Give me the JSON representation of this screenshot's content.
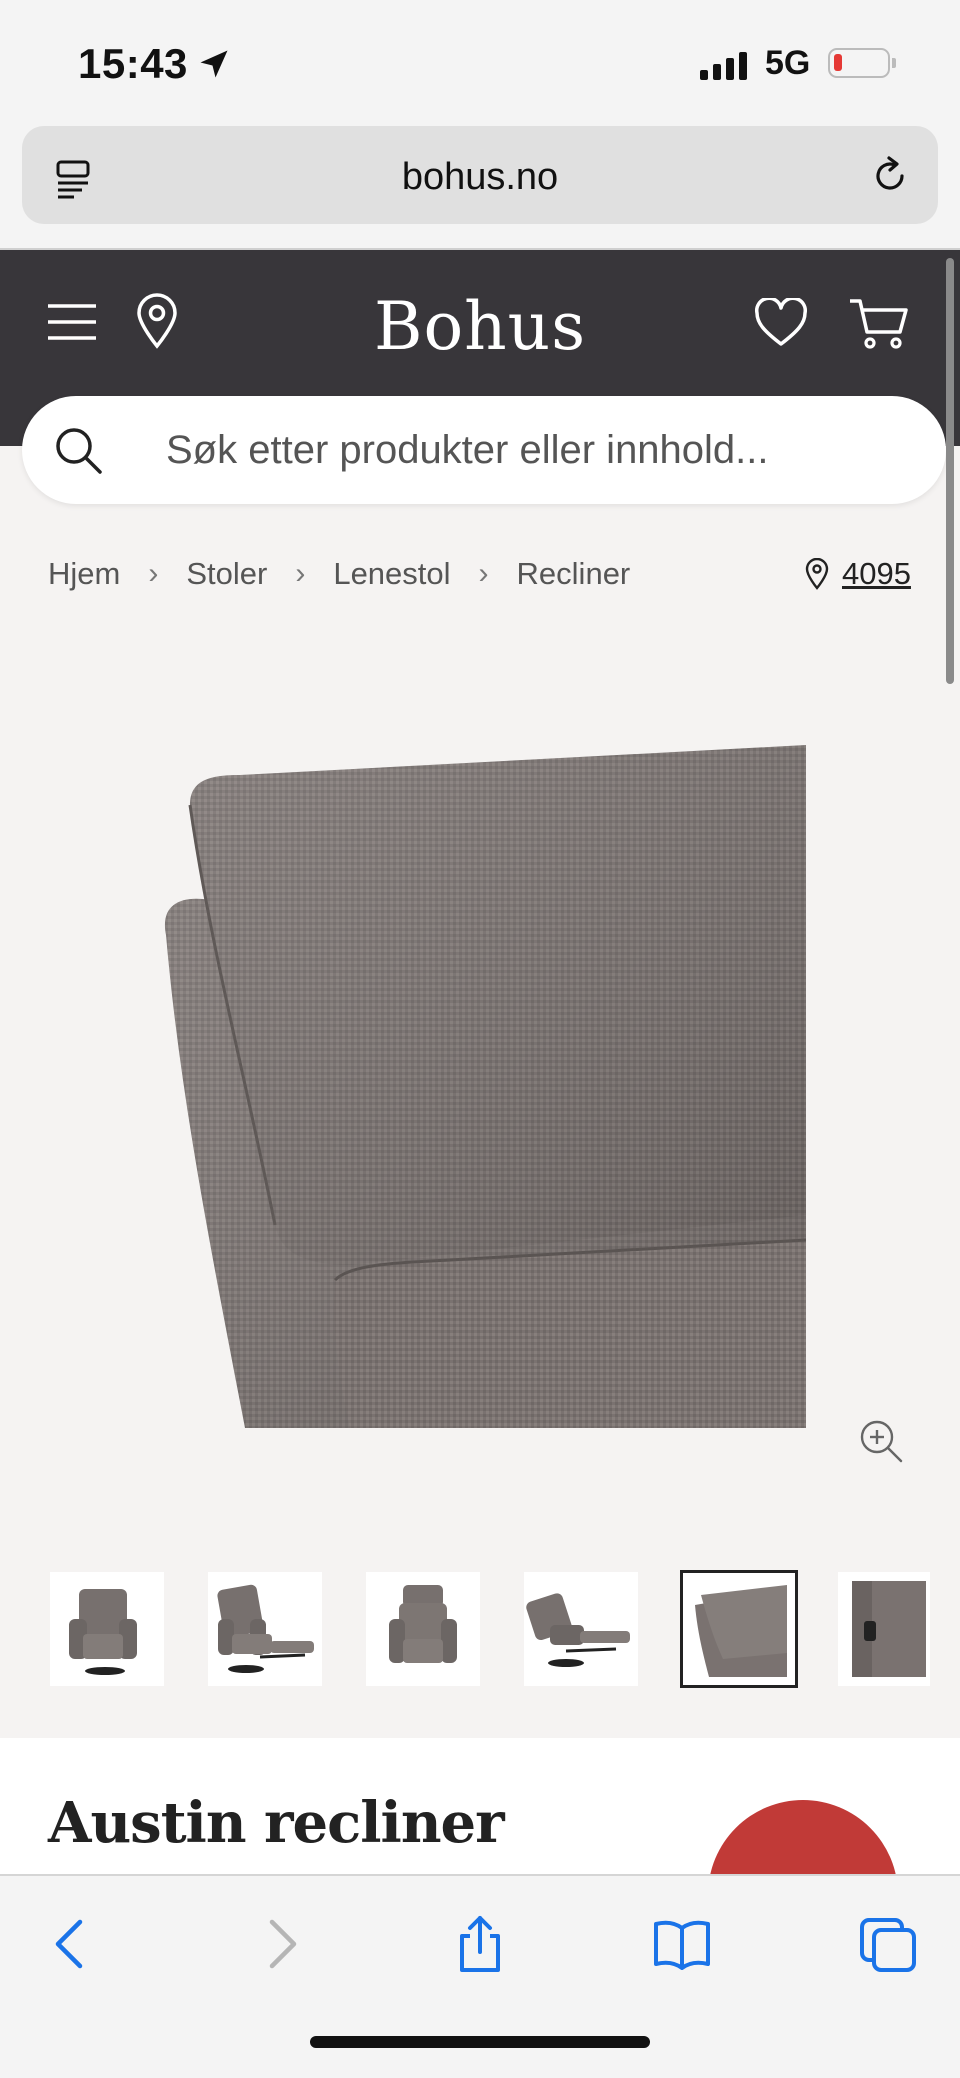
{
  "status_bar": {
    "time": "15:43",
    "network": "5G",
    "battery_level": 0.1
  },
  "browser": {
    "url": "bohus.no"
  },
  "header": {
    "brand": "Bohus"
  },
  "search": {
    "placeholder": "Søk etter produkter eller innhold..."
  },
  "breadcrumb": {
    "items": [
      "Hjem",
      "Stoler",
      "Lenestol",
      "Recliner"
    ],
    "separator": "›"
  },
  "store": {
    "number": "4095"
  },
  "thumbnails": {
    "count": 6,
    "active_index": 4
  },
  "product": {
    "title": "Austin recliner"
  },
  "colors": {
    "header_bg": "#38363a",
    "sale_red": "#c13a37",
    "link_blue": "#1a73e8"
  }
}
